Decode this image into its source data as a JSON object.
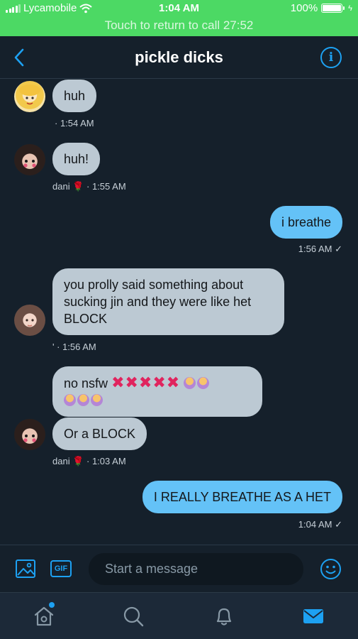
{
  "status_bar": {
    "carrier": "Lycamobile",
    "time": "1:04 AM",
    "battery": "100%",
    "battery_level": 1.0
  },
  "call_banner": "Touch to return to call 27:52",
  "header": {
    "title": "pickle dicks",
    "back_icon": "chevron-left-icon",
    "info_icon": "info-icon"
  },
  "messages": [
    {
      "direction": "incoming",
      "text": "huh",
      "meta": "· 1:54 AM"
    },
    {
      "direction": "incoming",
      "text": "huh!",
      "sender": "dani",
      "sender_emoji": "🌹",
      "meta": "· 1:55 AM"
    },
    {
      "direction": "outgoing",
      "text": "i breathe",
      "meta": "1:56 AM ✓"
    },
    {
      "direction": "incoming",
      "text": "you prolly said something about sucking jin and they were like het BLOCK",
      "meta_prefix": "'",
      "meta": "· 1:56 AM"
    },
    {
      "direction": "incoming",
      "text": "no nsfw",
      "x_marks": "✖✖✖✖✖"
    },
    {
      "direction": "incoming",
      "text": "Or a BLOCK",
      "sender": "dani",
      "sender_emoji": "🌹",
      "meta": "· 1:03 AM"
    },
    {
      "direction": "outgoing",
      "text": "I REALLY BREATHE AS A HET",
      "meta": "1:04 AM ✓"
    }
  ],
  "composer": {
    "placeholder": "Start a message",
    "gif_label": "GIF"
  },
  "colors": {
    "background": "#15202b",
    "accent": "#1da1f2",
    "call_green": "#4cd964",
    "incoming_bubble": "#bcc9d3",
    "outgoing_bubble": "#64c2f7"
  },
  "tabbar": {
    "icons": [
      "home-icon",
      "search-icon",
      "notifications-icon",
      "messages-icon"
    ]
  }
}
